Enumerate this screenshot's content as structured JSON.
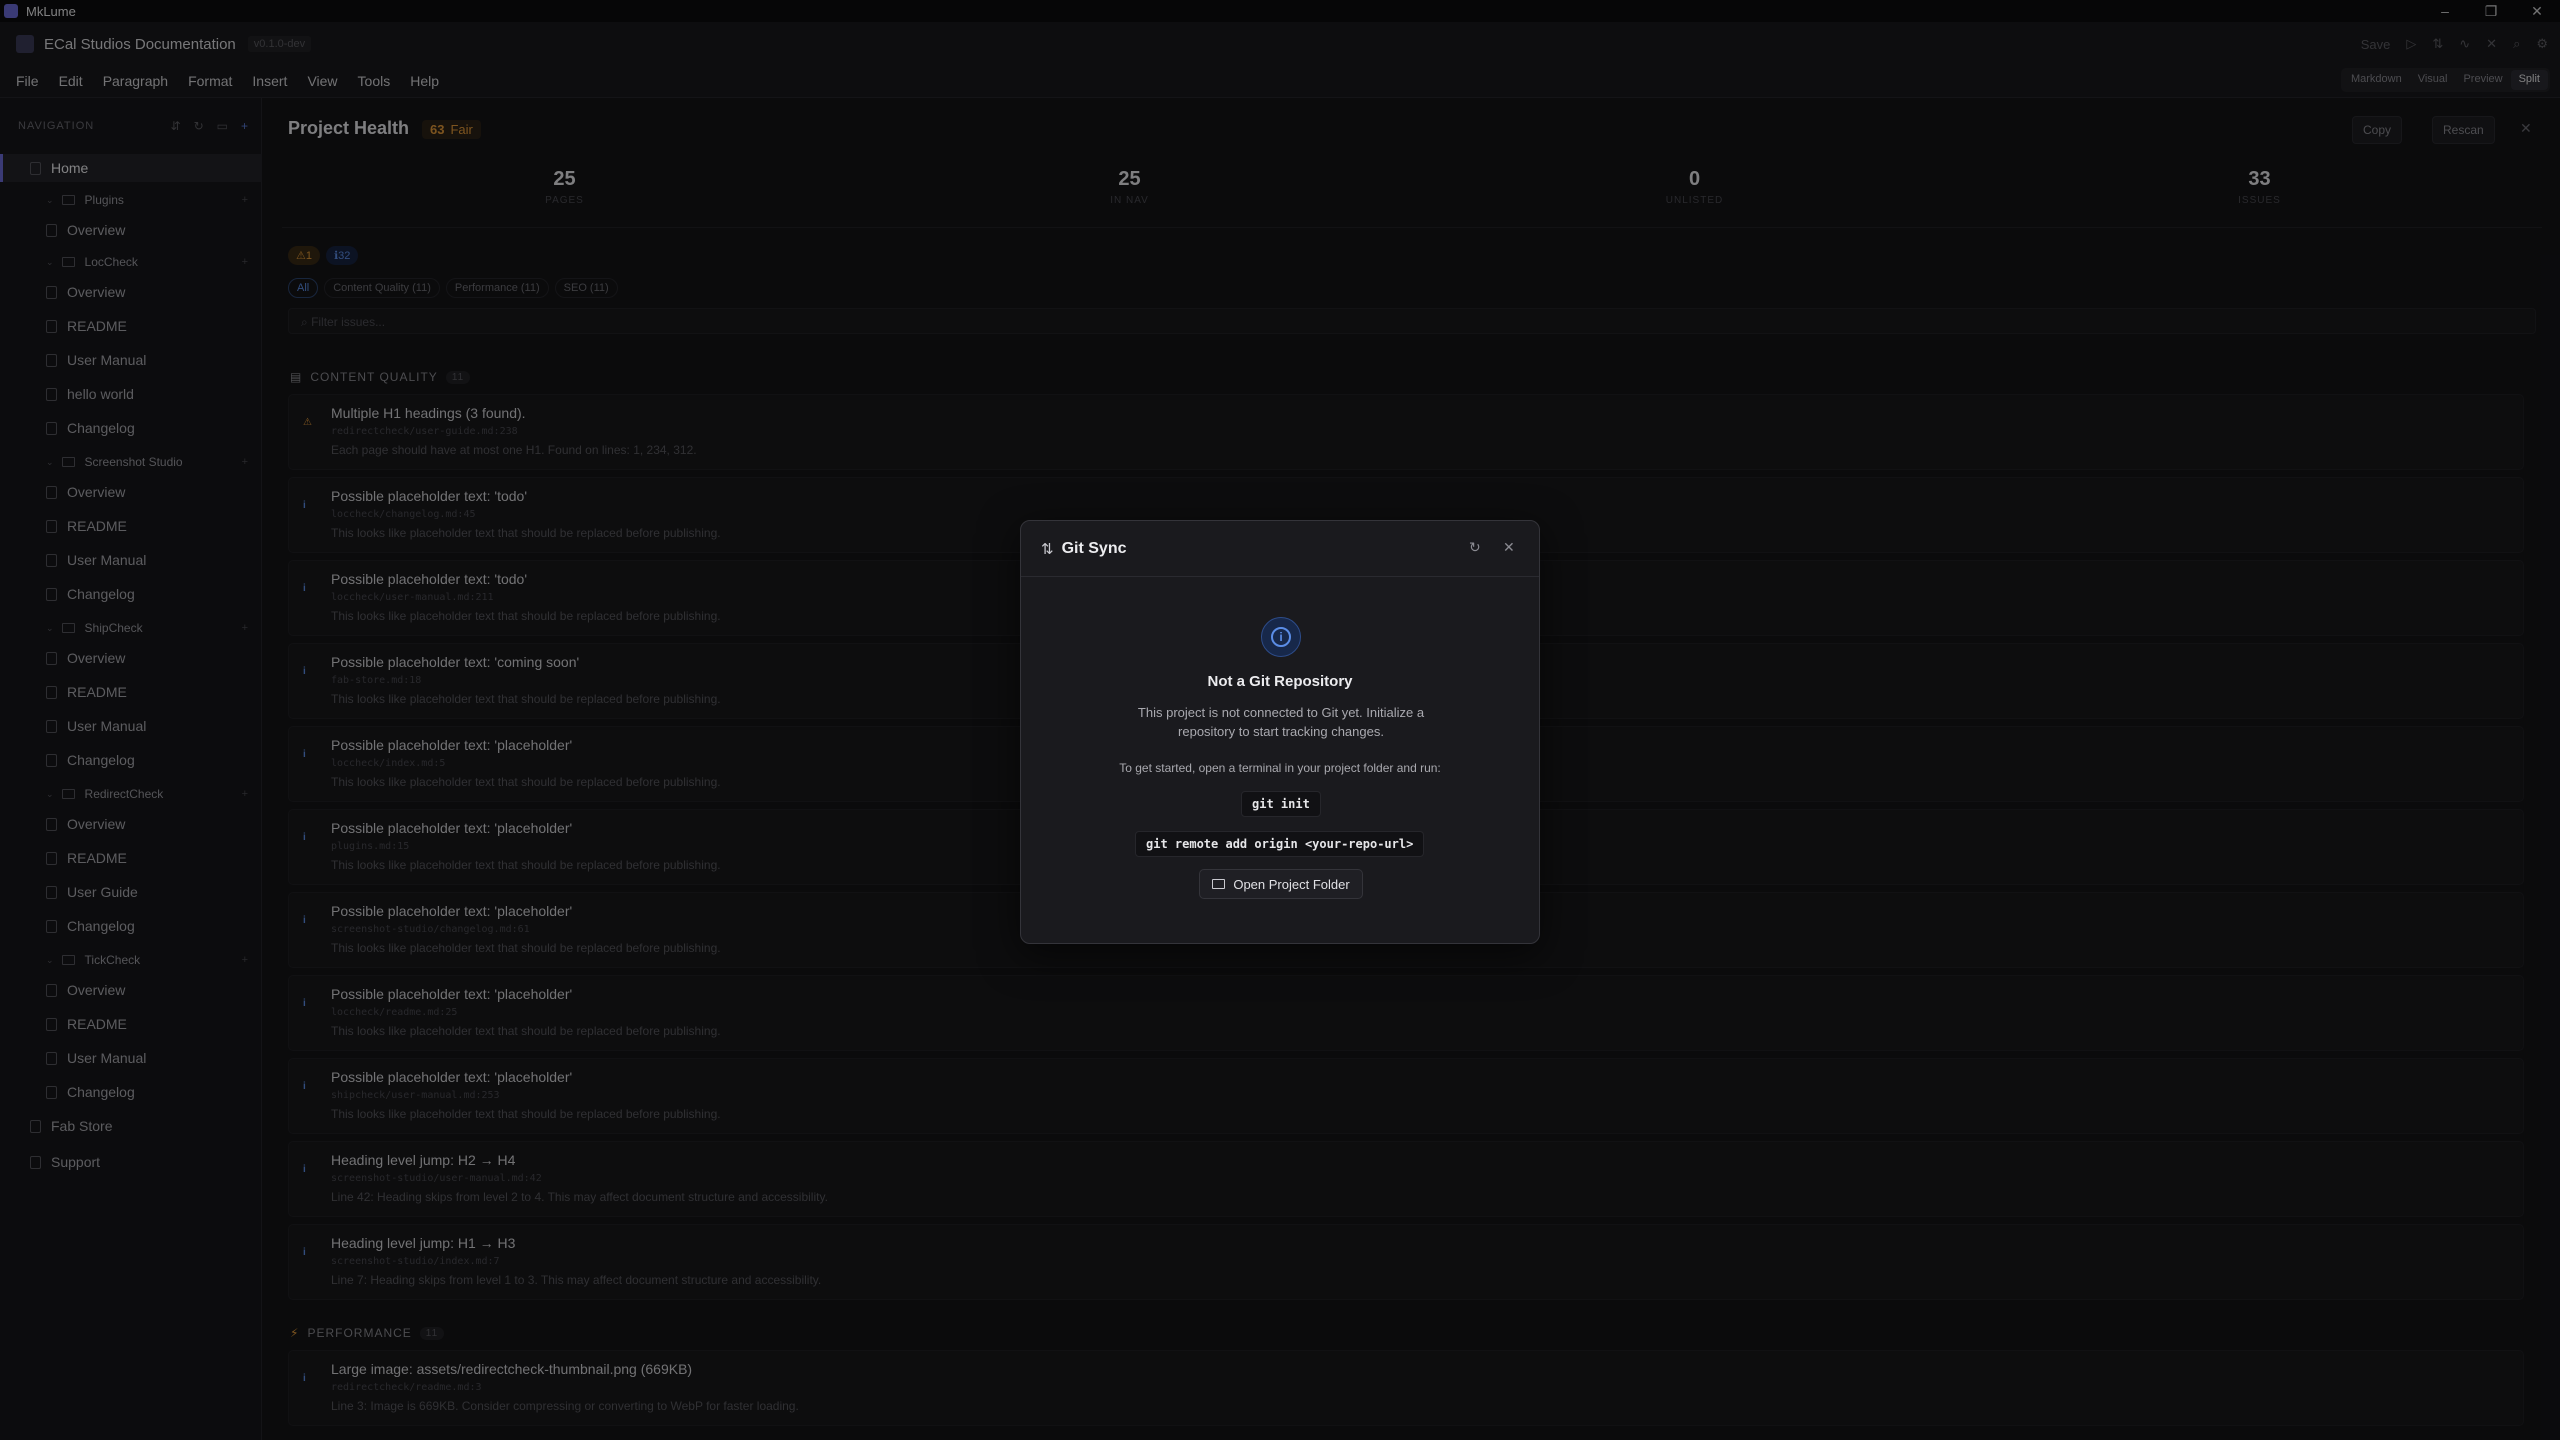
{
  "window": {
    "title": "MkLume",
    "controls": [
      "–",
      "❐",
      "✕"
    ]
  },
  "header": {
    "doc_title": "ECal Studios Documentation",
    "version": "v0.1.0-dev",
    "save_label": "Save",
    "menu": [
      "File",
      "Edit",
      "Paragraph",
      "Format",
      "Insert",
      "View",
      "Tools",
      "Help"
    ],
    "view_modes": [
      "Markdown",
      "Visual",
      "Preview",
      "Split"
    ],
    "active_view": "Split"
  },
  "sidebar": {
    "heading": "NAVIGATION",
    "items": [
      {
        "label": "Home",
        "type": "page",
        "active": true
      },
      {
        "label": "Plugins",
        "type": "folder"
      },
      {
        "label": "Overview",
        "type": "page"
      },
      {
        "label": "LocCheck",
        "type": "folder"
      },
      {
        "label": "Overview",
        "type": "page"
      },
      {
        "label": "README",
        "type": "page"
      },
      {
        "label": "User Manual",
        "type": "page"
      },
      {
        "label": "hello world",
        "type": "page"
      },
      {
        "label": "Changelog",
        "type": "page"
      },
      {
        "label": "Screenshot Studio",
        "type": "folder"
      },
      {
        "label": "Overview",
        "type": "page"
      },
      {
        "label": "README",
        "type": "page"
      },
      {
        "label": "User Manual",
        "type": "page"
      },
      {
        "label": "Changelog",
        "type": "page"
      },
      {
        "label": "ShipCheck",
        "type": "folder"
      },
      {
        "label": "Overview",
        "type": "page"
      },
      {
        "label": "README",
        "type": "page"
      },
      {
        "label": "User Manual",
        "type": "page"
      },
      {
        "label": "Changelog",
        "type": "page"
      },
      {
        "label": "RedirectCheck",
        "type": "folder"
      },
      {
        "label": "Overview",
        "type": "page"
      },
      {
        "label": "README",
        "type": "page"
      },
      {
        "label": "User Guide",
        "type": "page"
      },
      {
        "label": "Changelog",
        "type": "page"
      },
      {
        "label": "TickCheck",
        "type": "folder"
      },
      {
        "label": "Overview",
        "type": "page"
      },
      {
        "label": "README",
        "type": "page"
      },
      {
        "label": "User Manual",
        "type": "page"
      },
      {
        "label": "Changelog",
        "type": "page"
      },
      {
        "label": "Fab Store",
        "type": "page"
      },
      {
        "label": "Support",
        "type": "page"
      }
    ]
  },
  "health": {
    "title": "Project Health",
    "score": "63",
    "score_label": "Fair",
    "copy_label": "Copy",
    "rescan_label": "Rescan",
    "stats": [
      {
        "value": "25",
        "label": "PAGES"
      },
      {
        "value": "25",
        "label": "IN NAV"
      },
      {
        "value": "0",
        "label": "UNLISTED"
      },
      {
        "value": "33",
        "label": "ISSUES"
      }
    ],
    "badge_warn": "⚠1",
    "badge_info": "ℹ32",
    "filters": [
      "All",
      "Content Quality (11)",
      "Performance (11)",
      "SEO (11)"
    ],
    "filter_placeholder": "Filter issues...",
    "sections": [
      {
        "name": "CONTENT QUALITY",
        "count": "11"
      },
      {
        "name": "PERFORMANCE",
        "count": "11"
      }
    ],
    "issues": [
      {
        "severity": "warning",
        "title": "Multiple H1 headings (3 found).",
        "path": "redirectcheck/user-guide.md:238",
        "desc": "Each page should have at most one H1. Found on lines: 1, 234, 312."
      },
      {
        "severity": "info",
        "title": "Possible placeholder text: 'todo'",
        "path": "loccheck/changelog.md:45",
        "desc": "This looks like placeholder text that should be replaced before publishing."
      },
      {
        "severity": "info",
        "title": "Possible placeholder text: 'todo'",
        "path": "loccheck/user-manual.md:211",
        "desc": "This looks like placeholder text that should be replaced before publishing."
      },
      {
        "severity": "info",
        "title": "Possible placeholder text: 'coming soon'",
        "path": "fab-store.md:18",
        "desc": "This looks like placeholder text that should be replaced before publishing."
      },
      {
        "severity": "info",
        "title": "Possible placeholder text: 'placeholder'",
        "path": "loccheck/index.md:5",
        "desc": "This looks like placeholder text that should be replaced before publishing."
      },
      {
        "severity": "info",
        "title": "Possible placeholder text: 'placeholder'",
        "path": "plugins.md:15",
        "desc": "This looks like placeholder text that should be replaced before publishing."
      },
      {
        "severity": "info",
        "title": "Possible placeholder text: 'placeholder'",
        "path": "screenshot-studio/changelog.md:61",
        "desc": "This looks like placeholder text that should be replaced before publishing."
      },
      {
        "severity": "info",
        "title": "Possible placeholder text: 'placeholder'",
        "path": "loccheck/readme.md:25",
        "desc": "This looks like placeholder text that should be replaced before publishing."
      },
      {
        "severity": "info",
        "title": "Possible placeholder text: 'placeholder'",
        "path": "shipcheck/user-manual.md:253",
        "desc": "This looks like placeholder text that should be replaced before publishing."
      },
      {
        "severity": "info",
        "title": "Heading level jump: H2 → H4",
        "path": "screenshot-studio/user-manual.md:42",
        "desc": "Line 42: Heading skips from level 2 to 4. This may affect document structure and accessibility."
      },
      {
        "severity": "info",
        "title": "Heading level jump: H1 → H3",
        "path": "screenshot-studio/index.md:7",
        "desc": "Line 7: Heading skips from level 1 to 3. This may affect document structure and accessibility."
      },
      {
        "severity": "info",
        "title": "Large image: assets/redirectcheck-thumbnail.png (669KB)",
        "path": "redirectcheck/readme.md:3",
        "desc": "Line 3: Image is 669KB. Consider compressing or converting to WebP for faster loading."
      }
    ]
  },
  "dialog": {
    "title": "Git Sync",
    "heading": "Not a Git Repository",
    "body": "This project is not connected to Git yet. Initialize a repository to start tracking changes.",
    "hint": "To get started, open a terminal in your project folder and run:",
    "cmd1": "git init",
    "cmd2": "git remote add origin <your-repo-url>",
    "button": "Open Project Folder"
  },
  "colors": {
    "accent": "#5b8de6",
    "warning": "#e39a3a",
    "brand": "#6b6bd6"
  }
}
